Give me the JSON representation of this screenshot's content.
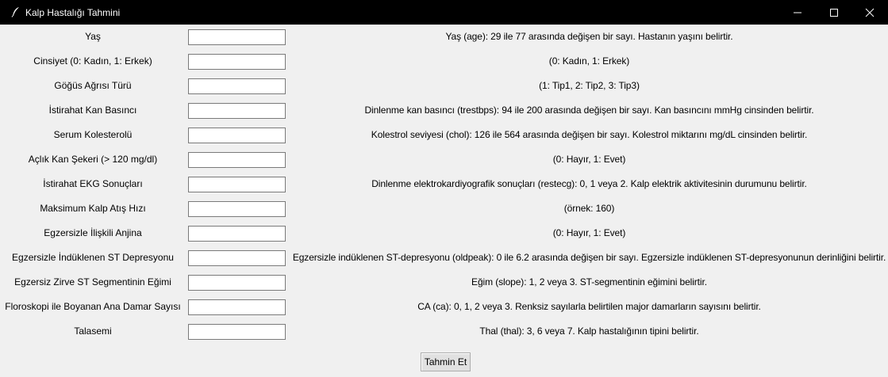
{
  "window": {
    "title": "Kalp Hastalığı Tahmini"
  },
  "fields": [
    {
      "label": "Yaş",
      "value": "",
      "hint": "Yaş (age): 29 ile 77 arasında değişen bir sayı. Hastanın yaşını belirtir."
    },
    {
      "label": "Cinsiyet (0: Kadın, 1: Erkek)",
      "value": "",
      "hint": "(0: Kadın, 1: Erkek)"
    },
    {
      "label": "Göğüs Ağrısı Türü",
      "value": "",
      "hint": "(1: Tip1, 2: Tip2, 3: Tip3)"
    },
    {
      "label": "İstirahat Kan Basıncı",
      "value": "",
      "hint": "Dinlenme kan basıncı (trestbps): 94 ile 200 arasında değişen bir sayı. Kan basıncını mmHg cinsinden belirtir."
    },
    {
      "label": "Serum Kolesterolü",
      "value": "",
      "hint": "Kolestrol seviyesi (chol): 126 ile 564 arasında değişen bir sayı. Kolestrol miktarını mg/dL cinsinden belirtir."
    },
    {
      "label": "Açlık Kan Şekeri (> 120 mg/dl)",
      "value": "",
      "hint": "(0: Hayır, 1: Evet)"
    },
    {
      "label": "İstirahat EKG Sonuçları",
      "value": "",
      "hint": "Dinlenme elektrokardiyografik sonuçları (restecg): 0, 1 veya 2. Kalp elektrik aktivitesinin durumunu belirtir."
    },
    {
      "label": "Maksimum Kalp Atış Hızı",
      "value": "",
      "hint": "(örnek: 160)"
    },
    {
      "label": "Egzersizle İlişkili Anjina",
      "value": "",
      "hint": "(0: Hayır, 1: Evet)"
    },
    {
      "label": "Egzersizle İndüklenen ST Depresyonu",
      "value": "",
      "hint": "Egzersizle indüklenen ST-depresyonu (oldpeak): 0 ile 6.2 arasında değişen bir sayı. Egzersizle indüklenen ST-depresyonunun derinliğini belirtir."
    },
    {
      "label": "Egzersiz Zirve ST Segmentinin Eğimi",
      "value": "",
      "hint": "Eğim (slope): 1, 2 veya 3. ST-segmentinin eğimini belirtir."
    },
    {
      "label": "Floroskopi ile Boyanan Ana Damar Sayısı",
      "value": "",
      "hint": "CA (ca): 0, 1, 2 veya 3. Renksiz sayılarla belirtilen major damarların sayısını belirtir."
    },
    {
      "label": "Talasemi",
      "value": "",
      "hint": "Thal (thal): 3, 6 veya 7. Kalp hastalığının tipini belirtir."
    }
  ],
  "actions": {
    "predict_label": "Tahmin Et"
  },
  "icons": {
    "app": "feather-icon",
    "minimize": "minimize-icon",
    "maximize": "maximize-icon",
    "close": "close-icon"
  },
  "colors": {
    "titlebar_bg": "#000000",
    "window_bg": "#f0f0f0",
    "input_border": "#7a7a7a",
    "button_bg": "#e1e1e1"
  }
}
